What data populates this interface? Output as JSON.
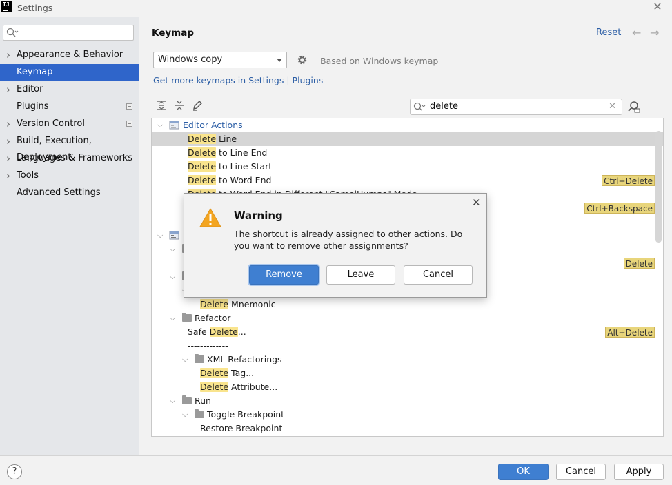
{
  "window": {
    "title": "Settings",
    "app_icon_text": "IJ",
    "close_glyph": "✕"
  },
  "sidebar": {
    "search": {
      "value": "",
      "placeholder": ""
    },
    "items": [
      {
        "label": "Appearance & Behavior",
        "expandable": true,
        "selected": false,
        "badge": false
      },
      {
        "label": "Keymap",
        "expandable": false,
        "selected": true,
        "badge": false
      },
      {
        "label": "Editor",
        "expandable": true,
        "selected": false,
        "badge": false
      },
      {
        "label": "Plugins",
        "expandable": false,
        "selected": false,
        "badge": true
      },
      {
        "label": "Version Control",
        "expandable": true,
        "selected": false,
        "badge": true
      },
      {
        "label": "Build, Execution, Deployment",
        "expandable": true,
        "selected": false,
        "badge": false
      },
      {
        "label": "Languages & Frameworks",
        "expandable": true,
        "selected": false,
        "badge": false
      },
      {
        "label": "Tools",
        "expandable": true,
        "selected": false,
        "badge": false
      },
      {
        "label": "Advanced Settings",
        "expandable": false,
        "selected": false,
        "badge": false
      }
    ]
  },
  "main": {
    "title": "Keymap",
    "reset_label": "Reset",
    "back_glyph": "←",
    "forward_glyph": "→",
    "keymap_select": {
      "value": "Windows copy"
    },
    "based_on": "Based on Windows keymap",
    "more_keymaps_link": "Get more keymaps in Settings | Plugins",
    "filter": {
      "value": "delete",
      "clear_glyph": "✕"
    },
    "tree": {
      "rows": [
        {
          "indent": 0,
          "twisty": "open",
          "icon": "editor-actions",
          "parts": [
            [
              "Editor Actions",
              "link"
            ]
          ],
          "shortcut": "",
          "selected": false
        },
        {
          "indent": 2,
          "twisty": "",
          "icon": "",
          "parts": [
            [
              "Delete",
              "hl"
            ],
            [
              " Line",
              ""
            ]
          ],
          "shortcut": "",
          "selected": true
        },
        {
          "indent": 2,
          "twisty": "",
          "icon": "",
          "parts": [
            [
              "Delete",
              "hl"
            ],
            [
              " to Line End",
              ""
            ]
          ],
          "shortcut": "",
          "selected": false
        },
        {
          "indent": 2,
          "twisty": "",
          "icon": "",
          "parts": [
            [
              "Delete",
              "hl"
            ],
            [
              " to Line Start",
              ""
            ]
          ],
          "shortcut": "",
          "selected": false
        },
        {
          "indent": 2,
          "twisty": "",
          "icon": "",
          "parts": [
            [
              "Delete",
              "hl"
            ],
            [
              " to Word End",
              ""
            ]
          ],
          "shortcut": "Ctrl+Delete",
          "selected": false
        },
        {
          "indent": 2,
          "twisty": "",
          "icon": "",
          "parts": [
            [
              "Delete",
              "hl"
            ],
            [
              " to Word End in Different \"CamelHumps\" Mode",
              ""
            ]
          ],
          "shortcut": "",
          "selected": false
        },
        {
          "indent": 2,
          "twisty": "",
          "icon": "",
          "parts": [
            [
              "",
              ""
            ]
          ],
          "shortcut": "Ctrl+Backspace",
          "selected": false
        },
        {
          "indent": 0,
          "twisty": "",
          "icon": "",
          "parts": [
            [
              "",
              ""
            ]
          ],
          "shortcut": "",
          "selected": false
        },
        {
          "indent": 0,
          "twisty": "open",
          "icon": "main-menu",
          "parts": [
            [
              "",
              ""
            ]
          ],
          "shortcut": "",
          "selected": false
        },
        {
          "indent": 1,
          "twisty": "open",
          "icon": "folder",
          "parts": [
            [
              "",
              ""
            ]
          ],
          "shortcut": "",
          "selected": false
        },
        {
          "indent": 2,
          "twisty": "",
          "icon": "",
          "parts": [
            [
              "",
              ""
            ]
          ],
          "shortcut": "Delete",
          "selected": false
        },
        {
          "indent": 1,
          "twisty": "open",
          "icon": "folder",
          "parts": [
            [
              "",
              ""
            ]
          ],
          "shortcut": "",
          "selected": false
        },
        {
          "indent": 2,
          "twisty": "open",
          "icon": "",
          "parts": [
            [
              "",
              ""
            ]
          ],
          "shortcut": "",
          "selected": false
        },
        {
          "indent": 3,
          "twisty": "",
          "icon": "",
          "parts": [
            [
              "Delete",
              "hl"
            ],
            [
              " Mnemonic",
              ""
            ]
          ],
          "shortcut": "",
          "selected": false
        },
        {
          "indent": 1,
          "twisty": "open",
          "icon": "folder",
          "parts": [
            [
              "Refactor",
              ""
            ]
          ],
          "shortcut": "",
          "selected": false
        },
        {
          "indent": 2,
          "twisty": "",
          "icon": "",
          "parts": [
            [
              "Safe ",
              ""
            ],
            [
              "Delete",
              "hl"
            ],
            [
              "...",
              ""
            ]
          ],
          "shortcut": "Alt+Delete",
          "selected": false
        },
        {
          "indent": 2,
          "twisty": "",
          "icon": "",
          "parts": [
            [
              "-------------",
              ""
            ]
          ],
          "shortcut": "",
          "selected": false
        },
        {
          "indent": 2,
          "twisty": "open",
          "icon": "folder",
          "parts": [
            [
              "XML Refactorings",
              ""
            ]
          ],
          "shortcut": "",
          "selected": false
        },
        {
          "indent": 3,
          "twisty": "",
          "icon": "",
          "parts": [
            [
              "Delete",
              "hl"
            ],
            [
              " Tag...",
              ""
            ]
          ],
          "shortcut": "",
          "selected": false
        },
        {
          "indent": 3,
          "twisty": "",
          "icon": "",
          "parts": [
            [
              "Delete",
              "hl"
            ],
            [
              " Attribute...",
              ""
            ]
          ],
          "shortcut": "",
          "selected": false
        },
        {
          "indent": 1,
          "twisty": "open",
          "icon": "folder",
          "parts": [
            [
              "Run",
              ""
            ]
          ],
          "shortcut": "",
          "selected": false
        },
        {
          "indent": 2,
          "twisty": "open",
          "icon": "folder",
          "parts": [
            [
              "Toggle Breakpoint",
              ""
            ]
          ],
          "shortcut": "",
          "selected": false
        },
        {
          "indent": 3,
          "twisty": "",
          "icon": "",
          "parts": [
            [
              "Restore Breakpoint",
              ""
            ]
          ],
          "shortcut": "",
          "selected": false
        }
      ]
    }
  },
  "dialog": {
    "title": "Warning",
    "message": "The shortcut is already assigned to other actions. Do you want to remove other assignments?",
    "close_glyph": "✕",
    "buttons": {
      "remove": "Remove",
      "leave": "Leave",
      "cancel": "Cancel"
    }
  },
  "footer": {
    "help_glyph": "?",
    "ok_label": "OK",
    "cancel_label": "Cancel",
    "apply_label": "Apply"
  },
  "colors": {
    "selection": "#2f65ca",
    "link": "#2d5fa6",
    "highlight": "#f9e48d",
    "primary_button": "#3f7fd1",
    "warning": "#f3a521"
  }
}
